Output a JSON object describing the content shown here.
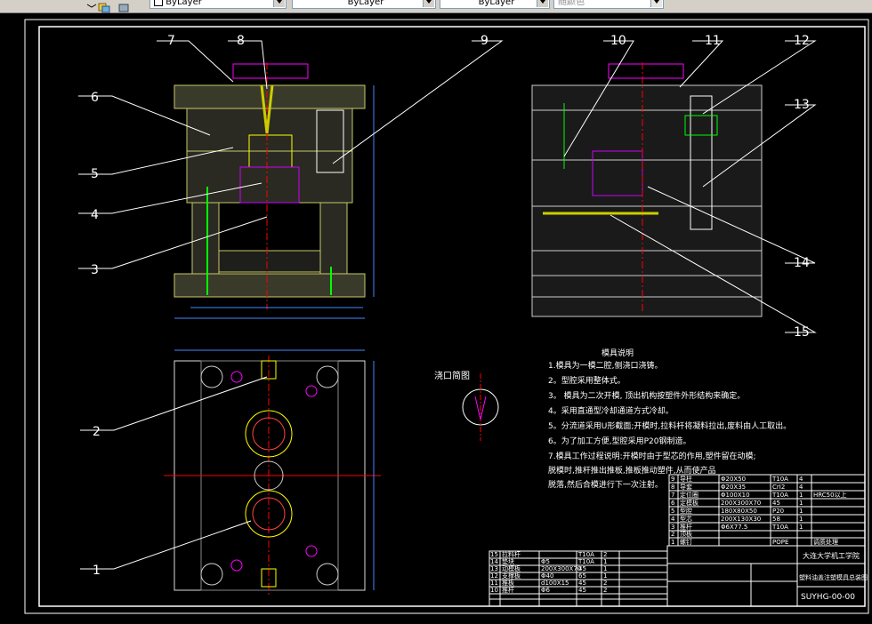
{
  "toolbar": {
    "color_value": "ByLayer",
    "linetype_value": "ByLayer",
    "lineweight_value": "ByLayer",
    "plotstyle_value": "随颜色"
  },
  "drawing": {
    "callouts": [
      "1",
      "2",
      "3",
      "4",
      "5",
      "6",
      "7",
      "8",
      "9",
      "10",
      "11",
      "12",
      "13",
      "14",
      "15"
    ],
    "gate_label": "浇口简图",
    "notes_title": "模具说明",
    "notes": [
      "1.模具为一模二腔,侧浇口浇铸。",
      "2。型腔采用整体式。",
      "3。 模具为二次开模, 顶出机构按塑件外形结构来确定。",
      "4。采用直通型冷却通道方式冷却。",
      "5。分流道采用U形截面;开模时,拉料杆将凝料拉出,废料由人工取出。",
      "6。为了加工方便,型腔采用P20钢制造。",
      "7.模具工作过程说明:开模时由于型芯的作用,塑件留在动模;",
      "  脱模时,推杆推出推板,推板推动塑件,从而使产品",
      "  脱落,然后合模进行下一次注射。"
    ],
    "title_block": {
      "school": "大连大学机工学院",
      "drawing_name": "塑料油盖注塑模具总装图",
      "drawing_no": "SUYHG-00-00"
    },
    "bom_right": [
      {
        "no": "9",
        "name": "导柱",
        "spec": "Φ20X50",
        "material": "T10A",
        "qty": "4",
        "note": ""
      },
      {
        "no": "8",
        "name": "导套",
        "spec": "Φ20X35",
        "material": "CrI2",
        "qty": "4",
        "note": ""
      },
      {
        "no": "7",
        "name": "定位圈",
        "spec": "Φ100X10",
        "material": "T10A",
        "qty": "1",
        "note": "HRC50以上"
      },
      {
        "no": "6",
        "name": "定模板",
        "spec": "200X300X70",
        "material": "45",
        "qty": "1",
        "note": ""
      },
      {
        "no": "5",
        "name": "型腔",
        "spec": "180X80X50",
        "material": "P20",
        "qty": "1",
        "note": ""
      },
      {
        "no": "4",
        "name": "型芯",
        "spec": "200X130X30",
        "material": "58",
        "qty": "1",
        "note": ""
      },
      {
        "no": "3",
        "name": "推杆",
        "spec": "Φ6X77.5",
        "material": "T10A",
        "qty": "1",
        "note": ""
      },
      {
        "no": "2",
        "name": "顶板",
        "spec": "",
        "material": "",
        "qty": "",
        "note": ""
      },
      {
        "no": "1",
        "name": "螺钉",
        "spec": "",
        "material": "POPE",
        "qty": "",
        "note": "调质处理"
      }
    ],
    "bom_left": [
      {
        "no": "15",
        "name": "拉料杆",
        "spec": "",
        "material": "T10A",
        "qty": "2"
      },
      {
        "no": "14",
        "name": "垫块",
        "spec": "Φ5",
        "material": "T10A",
        "qty": "1"
      },
      {
        "no": "13",
        "name": "动模板",
        "spec": "200X300X70",
        "material": "45",
        "qty": "1"
      },
      {
        "no": "12",
        "name": "支撑板",
        "spec": "Φ40",
        "material": "65",
        "qty": "1"
      },
      {
        "no": "11",
        "name": "推板",
        "spec": "d100X15",
        "material": "45",
        "qty": "2"
      },
      {
        "no": "10",
        "name": "推杆",
        "spec": "Φ6",
        "material": "45",
        "qty": "2"
      }
    ]
  }
}
